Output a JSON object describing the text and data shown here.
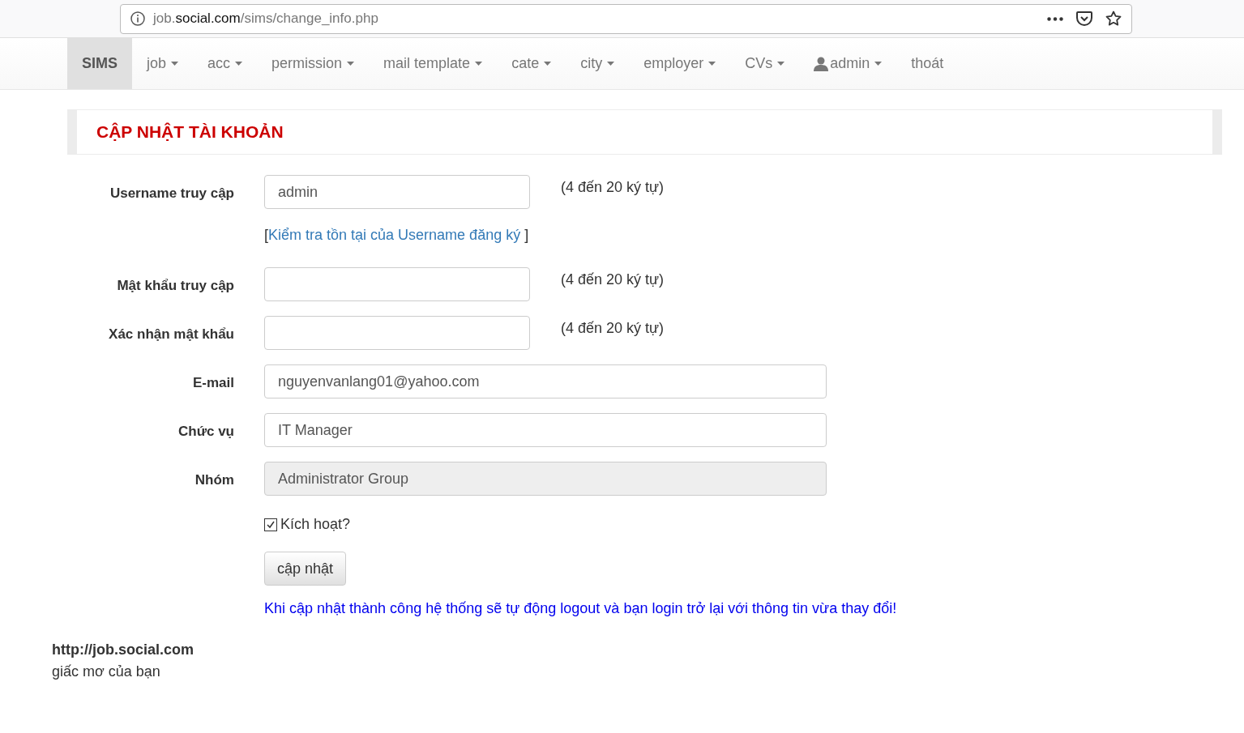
{
  "address_bar": {
    "url_start": "job.",
    "url_domain": "social.com",
    "url_path": "/sims/change_info.php"
  },
  "navbar": {
    "brand": {
      "label": "SIMS",
      "selected": true
    },
    "items": [
      {
        "kind": "dropdown",
        "label": "job"
      },
      {
        "kind": "dropdown",
        "label": "acc"
      },
      {
        "kind": "dropdown",
        "label": "permission"
      },
      {
        "kind": "dropdown",
        "label": "mail template"
      },
      {
        "kind": "dropdown",
        "label": "cate"
      },
      {
        "kind": "dropdown",
        "label": "city"
      },
      {
        "kind": "dropdown",
        "label": "employer"
      },
      {
        "kind": "dropdown",
        "label": "CVs"
      },
      {
        "kind": "user",
        "label": "admin"
      },
      {
        "kind": "link",
        "label": "thoát"
      }
    ]
  },
  "page_title": "CẬP NHẬT TÀI KHOẢN",
  "form": {
    "fields": [
      {
        "label": "Username truy cập",
        "value": "admin",
        "kind": "short",
        "disabled": false,
        "hint": "(4 đến 20 ký tự)",
        "link_open": "[",
        "link": "Kiểm tra tồn tại của Username đăng ký",
        "link_close": " ]"
      },
      {
        "label": "Mật khẩu truy cập",
        "kind": "short",
        "disabled": false,
        "hint": "(4 đến 20 ký tự)"
      },
      {
        "label": "Xác nhận mật khẩu",
        "kind": "short",
        "disabled": false,
        "hint": "(4 đến 20 ký tự)"
      },
      {
        "label": "E-mail",
        "value": "nguyenvanlang01@yahoo.com",
        "kind": "wide",
        "disabled": false
      },
      {
        "label": "Chức vụ",
        "value": "IT Manager",
        "kind": "wide",
        "disabled": false
      },
      {
        "label": "Nhóm",
        "value": "Administrator Group",
        "kind": "wide",
        "disabled": true
      }
    ],
    "active_checkbox": {
      "label": "Kích hoạt?",
      "checked": true
    },
    "submit": "cập nhật",
    "notice": "Khi cập nhật thành công hệ thống sẽ tự động logout và bạn login trở lại với thông tin vừa thay đổi!"
  },
  "footer": {
    "url": "http://job.social.com",
    "tagline": "giấc mơ của bạn"
  }
}
